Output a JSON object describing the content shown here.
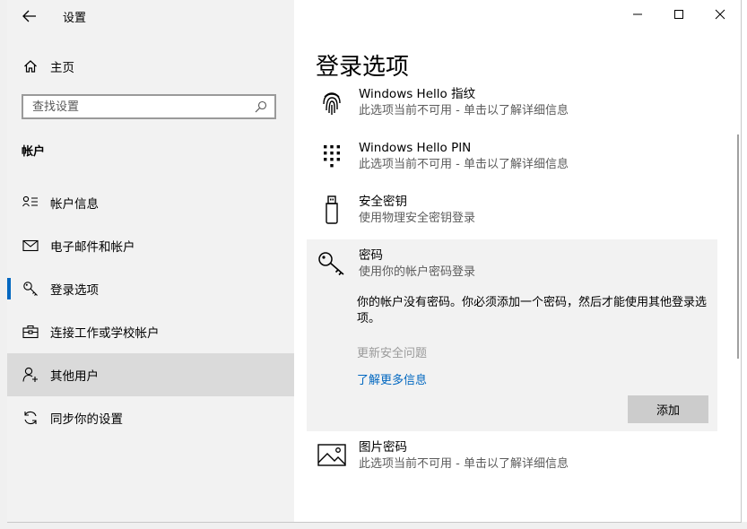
{
  "window": {
    "title": "设置",
    "controls": [
      "minimize-icon",
      "maximize-icon",
      "close-icon"
    ]
  },
  "sidebar": {
    "home_label": "主页",
    "search_placeholder": "查找设置",
    "section_heading": "帐户",
    "items": [
      {
        "label": "帐户信息",
        "icon": "account-info-icon",
        "selected": false,
        "hover": false
      },
      {
        "label": "电子邮件和帐户",
        "icon": "mail-icon",
        "selected": false,
        "hover": false
      },
      {
        "label": "登录选项",
        "icon": "key-icon",
        "selected": true,
        "hover": false
      },
      {
        "label": "连接工作或学校帐户",
        "icon": "briefcase-icon",
        "selected": false,
        "hover": false
      },
      {
        "label": "其他用户",
        "icon": "add-user-icon",
        "selected": false,
        "hover": true
      },
      {
        "label": "同步你的设置",
        "icon": "sync-icon",
        "selected": false,
        "hover": false
      }
    ]
  },
  "main": {
    "title": "登录选项",
    "options": [
      {
        "title": "Windows Hello 指纹",
        "desc": "此选项当前不可用 - 单击以了解详细信息",
        "icon": "fingerprint-icon"
      },
      {
        "title": "Windows Hello PIN",
        "desc": "此选项当前不可用 - 单击以了解详细信息",
        "icon": "pin-keypad-icon"
      },
      {
        "title": "安全密钥",
        "desc": "使用物理安全密钥登录",
        "icon": "usb-key-icon"
      },
      {
        "title": "密码",
        "desc": "使用你的帐户密码登录",
        "icon": "password-key-icon"
      },
      {
        "title": "图片密码",
        "desc": "此选项当前不可用 - 单击以了解详细信息",
        "icon": "picture-icon"
      }
    ],
    "password_expanded": {
      "message": "你的帐户没有密码。你必须添加一个密码，然后才能使用其他登录选项。",
      "update_security_questions": "更新安全问题",
      "learn_more": "了解更多信息",
      "add_button": "添加"
    }
  },
  "colors": {
    "accent": "#0067c0",
    "sidebar_bg": "#f2f2f2",
    "hover_bg": "#dadada",
    "button_bg": "#cccccc"
  }
}
